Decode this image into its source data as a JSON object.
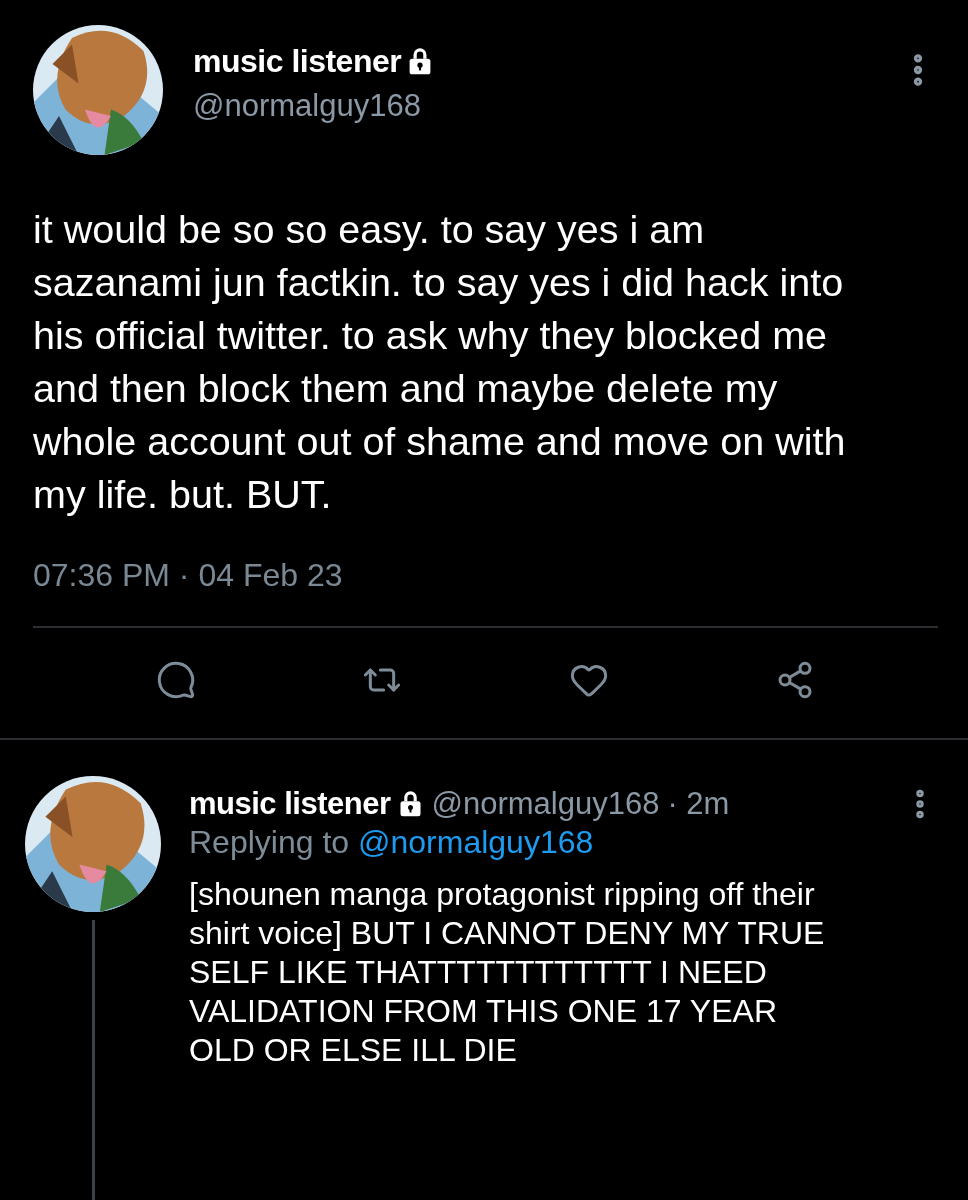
{
  "tweet": {
    "author": {
      "name": "music listener",
      "handle": "@normalguy168",
      "protected": true
    },
    "text": "it would be so so easy. to say yes i am sazanami jun factkin. to say yes i did hack into his official twitter. to ask why they blocked me and then block them and maybe delete my whole account out of shame and move on with my life. but. BUT.",
    "timestamp": "07:36 PM · 04 Feb 23",
    "actions": [
      {
        "kind": "reply"
      },
      {
        "kind": "retweet"
      },
      {
        "kind": "like"
      },
      {
        "kind": "share"
      }
    ]
  },
  "reply": {
    "author": {
      "name": "music listener",
      "handle": "@normalguy168",
      "protected": true
    },
    "time": "· 2m",
    "replying_prefix": "Replying to",
    "replying_handle": "@normalguy168",
    "text": "[shounen manga protagonist ripping off their shirt voice] BUT I CANNOT DENY MY TRUE SELF LIKE THATTTTTTTTTTTT I NEED VALIDATION FROM THIS ONE 17 YEAR OLD OR ELSE ILL DIE"
  }
}
